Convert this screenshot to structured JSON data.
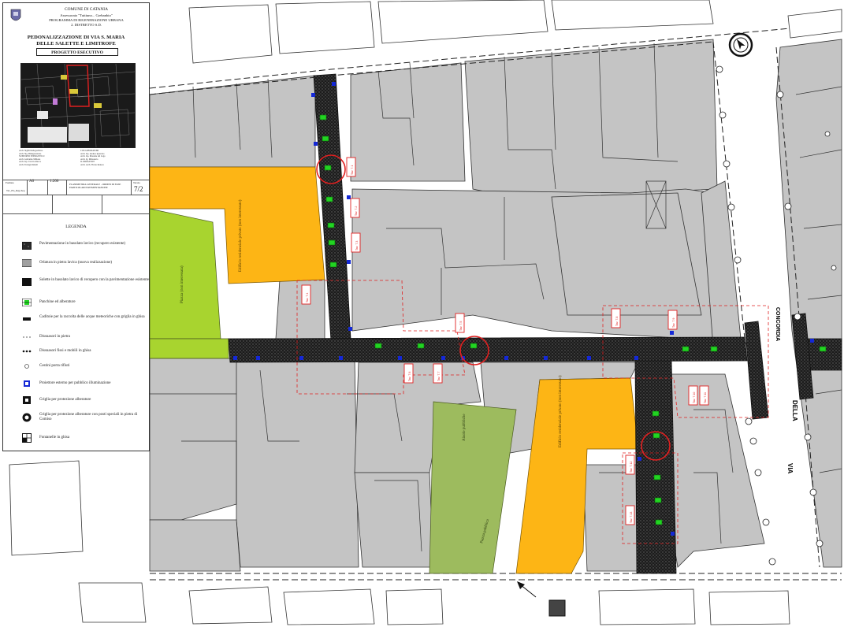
{
  "panel": {
    "header_lines": [
      "COMUNE DI CATANIA",
      "Assessorato \"Tuttiuno... Grebanbio\"",
      "PROGRAMMA DI RIGENERAZIONE URBANA",
      "2. DISTRETTO S.D."
    ],
    "project_title": [
      "PEDONALIZZAZIONE DI VIA S. MARIA",
      "DELLE SALETTE E LIMITROFE"
    ],
    "phase": "PROGETTO ESECUTIVO",
    "credits_left": [
      "Arch. Sigilli Rallegoribuso",
      "Arch. Sig. Biungerestano",
      "SUPPORTO ENERGETICO",
      "Arch. Gubrumo Milione",
      "Arch. Isp. Ciaccio Rucco",
      "Arch. Ferrugi Riabell"
    ],
    "credits_right": [
      "COLLABORATORI",
      "Arch. Isp. Andrea Igrestolo",
      "Arch. Isp. Massine del Lego",
      "Arch. Ig. Mileonolo",
      "IL DIRIGENTE",
      "Arch. Arch. Flavio Reneco"
    ],
    "table": {
      "format_label": "Formato",
      "format": "A0",
      "scale_label": "Scala",
      "scale": "1:200",
      "file": "Tav_Pla_Reg.dwg",
      "desc": "PLANIMETRIA GENERALE - ORDINI DI FASE PARTICOLARI PAVIMENTAZIONE",
      "sheet_label": "Tavola",
      "sheet": "7/2"
    },
    "legend": {
      "title": "LEGENDA",
      "items": [
        {
          "sym": "paving",
          "text": "Pavimentazione in basolato lavico (recupero esistente)"
        },
        {
          "sym": "curb",
          "text": "Orlatura in pietra lavica (nuova realizzazione)"
        },
        {
          "sym": "solid",
          "text": "Solette in basolato lavico di recupero con la pavimentazione esistente"
        },
        {
          "sym": "tree",
          "text": "Panchine ed alberature"
        },
        {
          "sym": "drain",
          "text": "Caditoie per la raccolta delle acque meteoriche con griglia in ghisa"
        },
        {
          "sym": "dots-grey",
          "text": "Dissuasori in pietra"
        },
        {
          "sym": "dots-black",
          "text": "Dissuasori fissi e mobili in ghisa"
        },
        {
          "sym": "circle",
          "text": "Cestini porta rifiuti"
        },
        {
          "sym": "lamp",
          "text": "Proiettore esterno per pubblico illuminazione"
        },
        {
          "sym": "grate",
          "text": "Griglia per protezione alberature"
        },
        {
          "sym": "grate-round",
          "text": "Griglia per protezione alberature con posti speciali in pietra di Comiso"
        },
        {
          "sym": "fountain",
          "text": "Fontanelle in ghisa"
        }
      ]
    }
  },
  "streets": {
    "main_name": [
      "VIA",
      "DELLA",
      "CONCORDIA"
    ]
  },
  "buildings": {
    "orange": [
      "Edificio residenziale privato (non interessato)",
      "Edificio residenziale privato (non interessato)"
    ],
    "green": [
      "Piazza (non interessata)",
      "Aiuole pubbliche",
      "Piazza pubblica"
    ]
  },
  "tags": [
    "Tav. 7.1",
    "Tav. 7.2",
    "Tav. 7.3",
    "Tav. 7.4",
    "Tav. 7.5",
    "Tav. 7.6",
    "Tav. 7.7",
    "Tav. 7.8",
    "Tav. 7.9",
    "Tav. 7.10",
    "Tav. 7.11",
    "Tav. 7.12",
    "Tav. 7.13"
  ],
  "colors": {
    "building_grey": "#c4c4c4",
    "orange": "#fdb515",
    "lime": "#a8d42f",
    "olive": "#9dbb5e",
    "paving": "#202020",
    "tree": "#22d422",
    "lamp": "#1428d6",
    "red": "#e02020"
  }
}
